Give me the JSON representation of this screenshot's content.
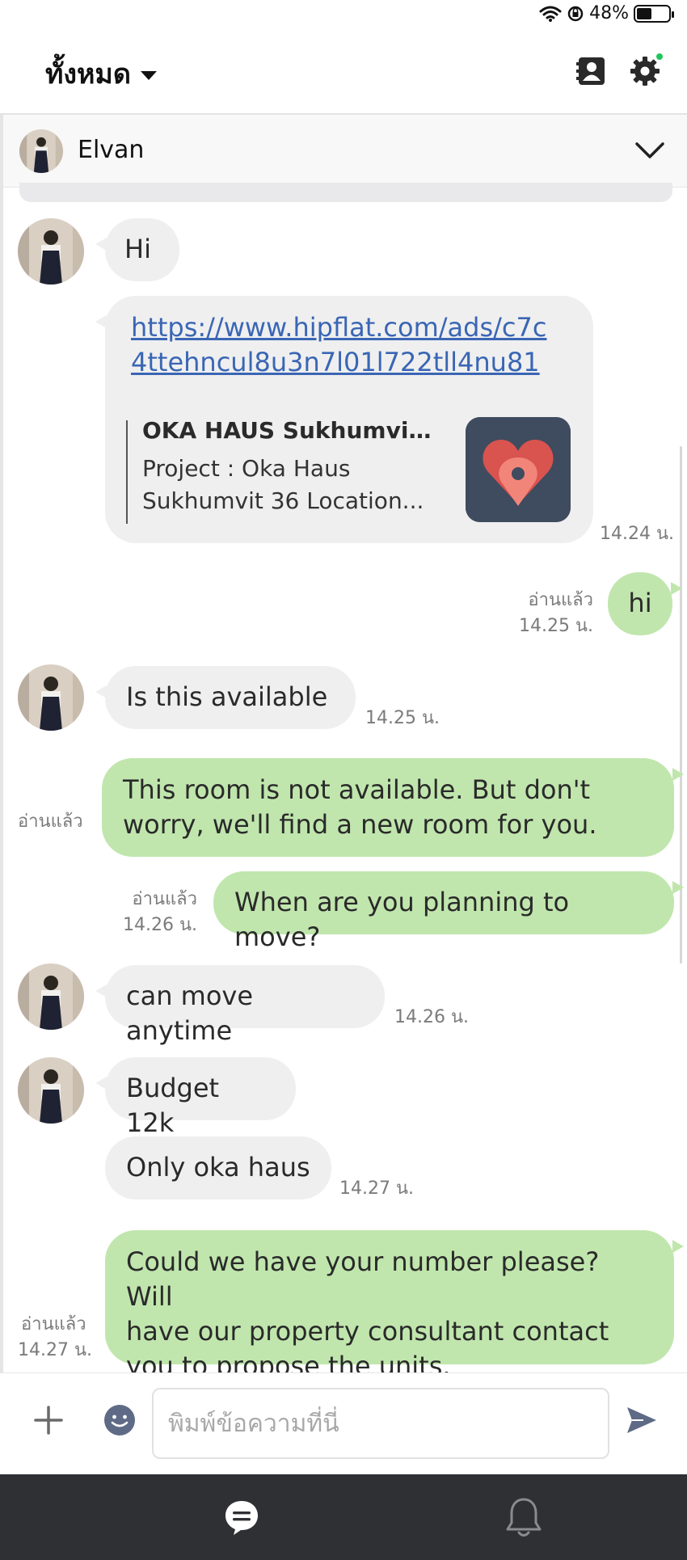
{
  "status_bar": {
    "battery": "48%",
    "battery_level": 0.48
  },
  "header": {
    "title": "ทั้งหมด"
  },
  "thread": {
    "name": "Elvan"
  },
  "messages": {
    "m1": {
      "text": "Hi"
    },
    "m2": {
      "url_line1": "https://www.hipflat.com/ads/c7c",
      "url_line2": "4ttehncul8u3n7l01l722tll4nu81",
      "preview_title": "OKA HAUS Sukhumvit ...",
      "preview_line1": "Project : Oka Haus",
      "preview_line2": "Sukhumvit 36 Location...",
      "time": "14.24 น."
    },
    "m3": {
      "text": "hi",
      "read": "อ่านแล้ว",
      "time": "14.25 น."
    },
    "m4": {
      "text": "Is this available",
      "time": "14.25 น."
    },
    "m5": {
      "line1": "This room is not available. But don't",
      "line2": "worry, we'll find a new room for you.",
      "read": "อ่านแล้ว"
    },
    "m6": {
      "text": "When are you planning to move?",
      "read": "อ่านแล้ว",
      "time": "14.26 น."
    },
    "m7": {
      "text": "can move anytime",
      "time": "14.26 น."
    },
    "m8": {
      "text": "Budget 12k"
    },
    "m9": {
      "text": "Only oka haus",
      "time": "14.27 น."
    },
    "m10": {
      "line1": "Could we have your number please? Will",
      "line2": "have our property consultant contact",
      "line3": "you to propose the units.",
      "read": "อ่านแล้ว",
      "time": "14.27 น."
    }
  },
  "composer": {
    "placeholder": "พิมพ์ข้อความที่นี่",
    "value": ""
  },
  "colors": {
    "incoming_bubble": "#efeff0",
    "outgoing_bubble": "#c0e6ad",
    "link": "#3a66b4",
    "nav_background": "#2f3034",
    "online_dot": "#1fc65c"
  },
  "icons": {
    "header": [
      "contacts-icon",
      "settings-icon"
    ],
    "composer": [
      "plus-icon",
      "emoji-icon",
      "send-icon"
    ],
    "nav": [
      "chat-icon",
      "bell-icon"
    ]
  }
}
